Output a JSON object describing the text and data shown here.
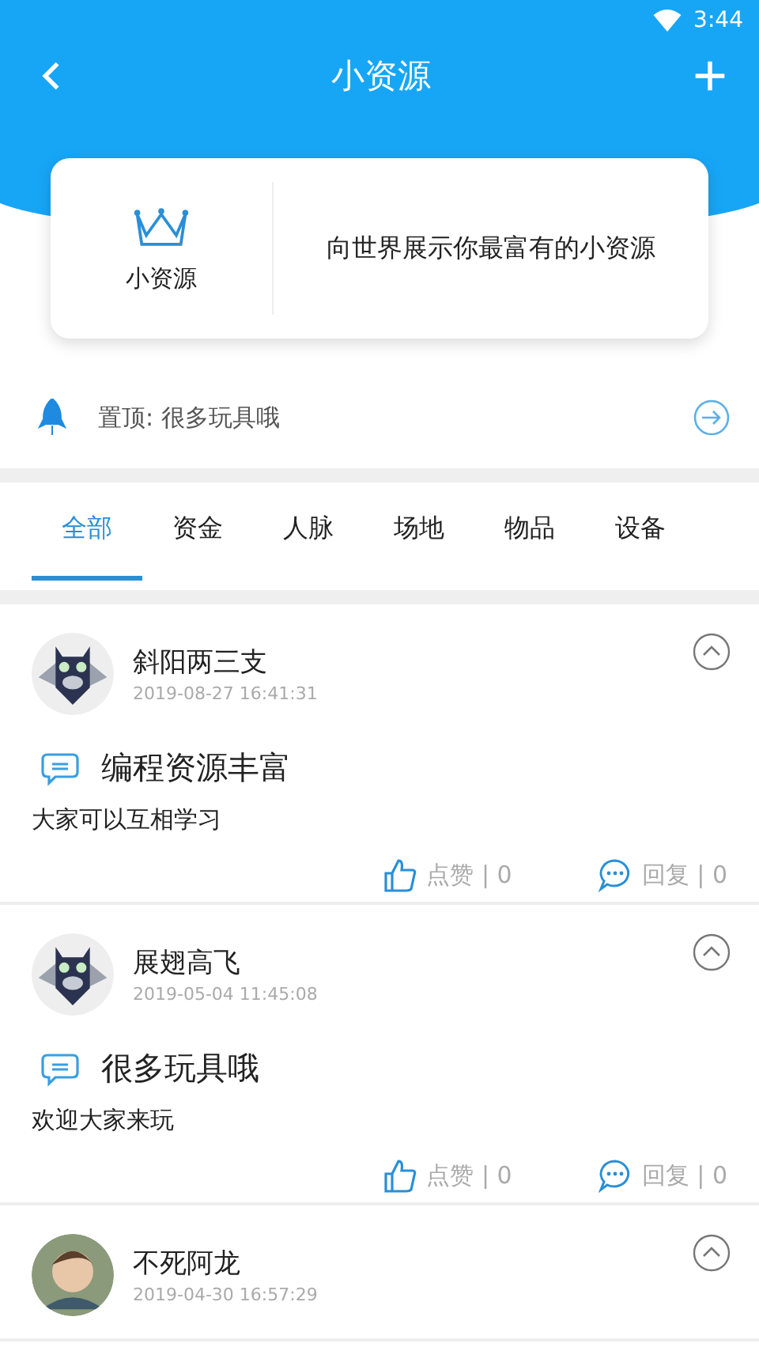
{
  "status_bar": {
    "time": "3:44"
  },
  "header": {
    "title": "小资源"
  },
  "intro_card": {
    "label": "小资源",
    "slogan": "向世界展示你最富有的小资源"
  },
  "pinned": {
    "text": "置顶: 很多玩具哦"
  },
  "tabs": [
    {
      "label": "全部",
      "selected": true
    },
    {
      "label": "资金",
      "selected": false
    },
    {
      "label": "人脉",
      "selected": false
    },
    {
      "label": "场地",
      "selected": false
    },
    {
      "label": "物品",
      "selected": false
    },
    {
      "label": "设备",
      "selected": false
    }
  ],
  "posts": [
    {
      "user": "斜阳两三支",
      "time": "2019-08-27 16:41:31",
      "title": "编程资源丰富",
      "body": "大家可以互相学习",
      "likes": "点赞 | 0",
      "replies": "回复 | 0"
    },
    {
      "user": "展翅高飞",
      "time": "2019-05-04 11:45:08",
      "title": "很多玩具哦",
      "body": "欢迎大家来玩",
      "likes": "点赞 | 0",
      "replies": "回复 | 0"
    },
    {
      "user": "不死阿龙",
      "time": "2019-04-30 16:57:29"
    }
  ]
}
